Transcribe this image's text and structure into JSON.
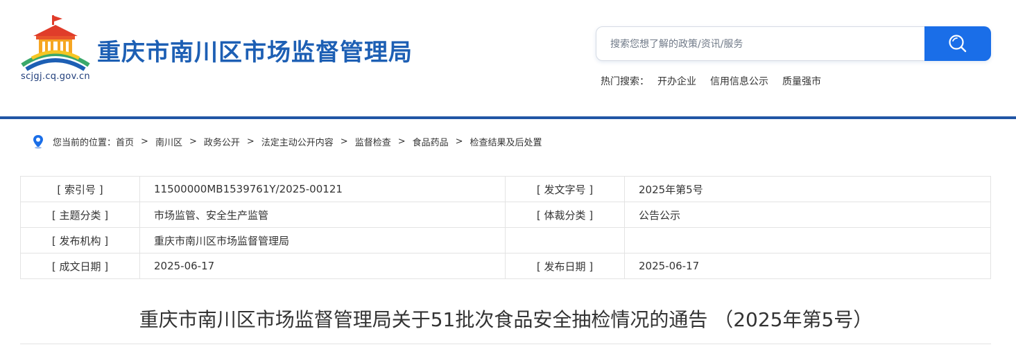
{
  "header": {
    "site_title": "重庆市南川区市场监督管理局",
    "domain": "scjgj.cq.gov.cn",
    "search": {
      "placeholder": "搜索您想了解的政策/资讯/服务"
    },
    "hot_search": {
      "label": "热门搜索：",
      "links": [
        "开办企业",
        "信用信息公示",
        "质量强市"
      ]
    }
  },
  "breadcrumb": {
    "prefix": "您当前的位置：",
    "items": [
      "首页",
      "南川区",
      "政务公开",
      "法定主动公开内容",
      "监督检查",
      "食品药品",
      "检查结果及后处置"
    ],
    "separator": ">"
  },
  "info": {
    "rows": [
      {
        "l1": "[ 索引号 ]",
        "v1": "11500000MB1539761Y/2025-00121",
        "l2": "[ 发文字号 ]",
        "v2": "2025年第5号"
      },
      {
        "l1": "[ 主题分类 ]",
        "v1": "市场监管、安全生产监管",
        "l2": "[ 体裁分类 ]",
        "v2": "公告公示"
      },
      {
        "l1": "[ 发布机构 ]",
        "v1": "重庆市南川区市场监督管理局",
        "l2": "",
        "v2": ""
      },
      {
        "l1": "[ 成文日期 ]",
        "v1": "2025-06-17",
        "l2": "[ 发布日期 ]",
        "v2": "2025-06-17"
      }
    ]
  },
  "article": {
    "title": "重庆市南川区市场监督管理局关于51批次食品安全抽检情况的通告 （2025年第5号）"
  },
  "colors": {
    "brand_blue": "#1d5fb4",
    "search_button": "#1a6ee8",
    "divider": "#2156a5"
  },
  "icons": {
    "logo": "government-building-emblem",
    "search": "search-icon",
    "location": "location-pin-icon"
  }
}
